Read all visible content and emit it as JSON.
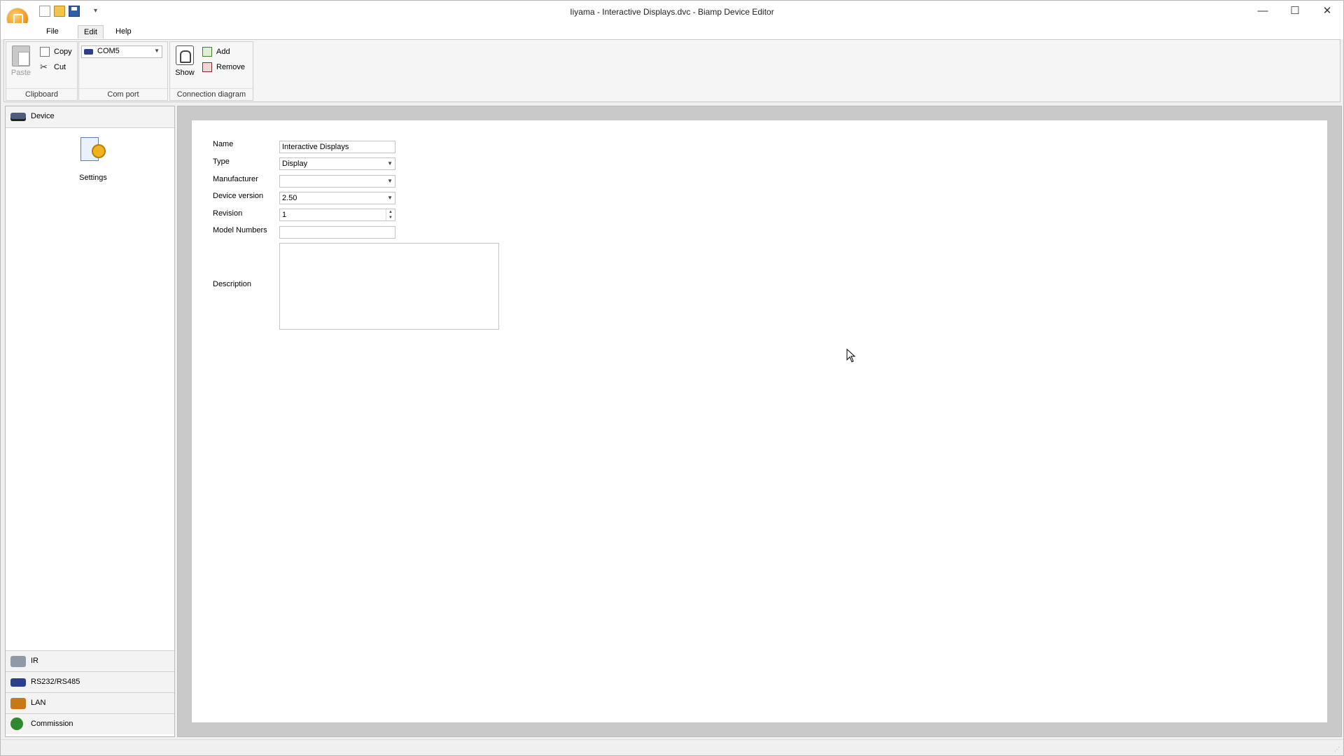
{
  "window": {
    "title": "Iiyama - Interactive Displays.dvc - Biamp Device Editor",
    "controls": {
      "minimize": "—",
      "maximize": "☐",
      "close": "✕"
    },
    "quick_access_more": "▾"
  },
  "menu": {
    "file": "File",
    "edit": "Edit",
    "help": "Help"
  },
  "ribbon": {
    "clipboard": {
      "paste": "Paste",
      "copy": "Copy",
      "cut": "Cut",
      "label": "Clipboard"
    },
    "com_port": {
      "value": "COM5",
      "label": "Com port"
    },
    "connection_diagram": {
      "show": "Show",
      "add": "Add",
      "remove": "Remove",
      "label": "Connection diagram"
    }
  },
  "left_panel": {
    "header": "Device",
    "settings_label": "Settings",
    "nav": [
      {
        "label": "IR"
      },
      {
        "label": "RS232/RS485"
      },
      {
        "label": "LAN"
      },
      {
        "label": "Commission"
      }
    ]
  },
  "form": {
    "name_label": "Name",
    "name_value": "Interactive Displays",
    "type_label": "Type",
    "type_value": "Display",
    "manufacturer_label": "Manufacturer",
    "manufacturer_value": "",
    "device_version_label": "Device version",
    "device_version_value": "2.50",
    "revision_label": "Revision",
    "revision_value": "1",
    "model_numbers_label": "Model Numbers",
    "model_numbers_value": "",
    "description_label": "Description",
    "description_value": ""
  },
  "icons": {
    "app": "biamp-app-icon",
    "new": "new-file-icon",
    "open": "open-folder-icon",
    "save": "save-icon",
    "paste": "paste-icon",
    "copy": "copy-icon",
    "cut": "scissors-icon",
    "com": "serial-port-icon",
    "show": "diagram-icon",
    "add": "add-icon",
    "remove": "remove-icon",
    "device": "device-icon",
    "settings": "settings-gear-icon",
    "ir": "ir-icon",
    "rs232": "serial-icon",
    "lan": "lan-icon",
    "commission": "commission-icon"
  }
}
